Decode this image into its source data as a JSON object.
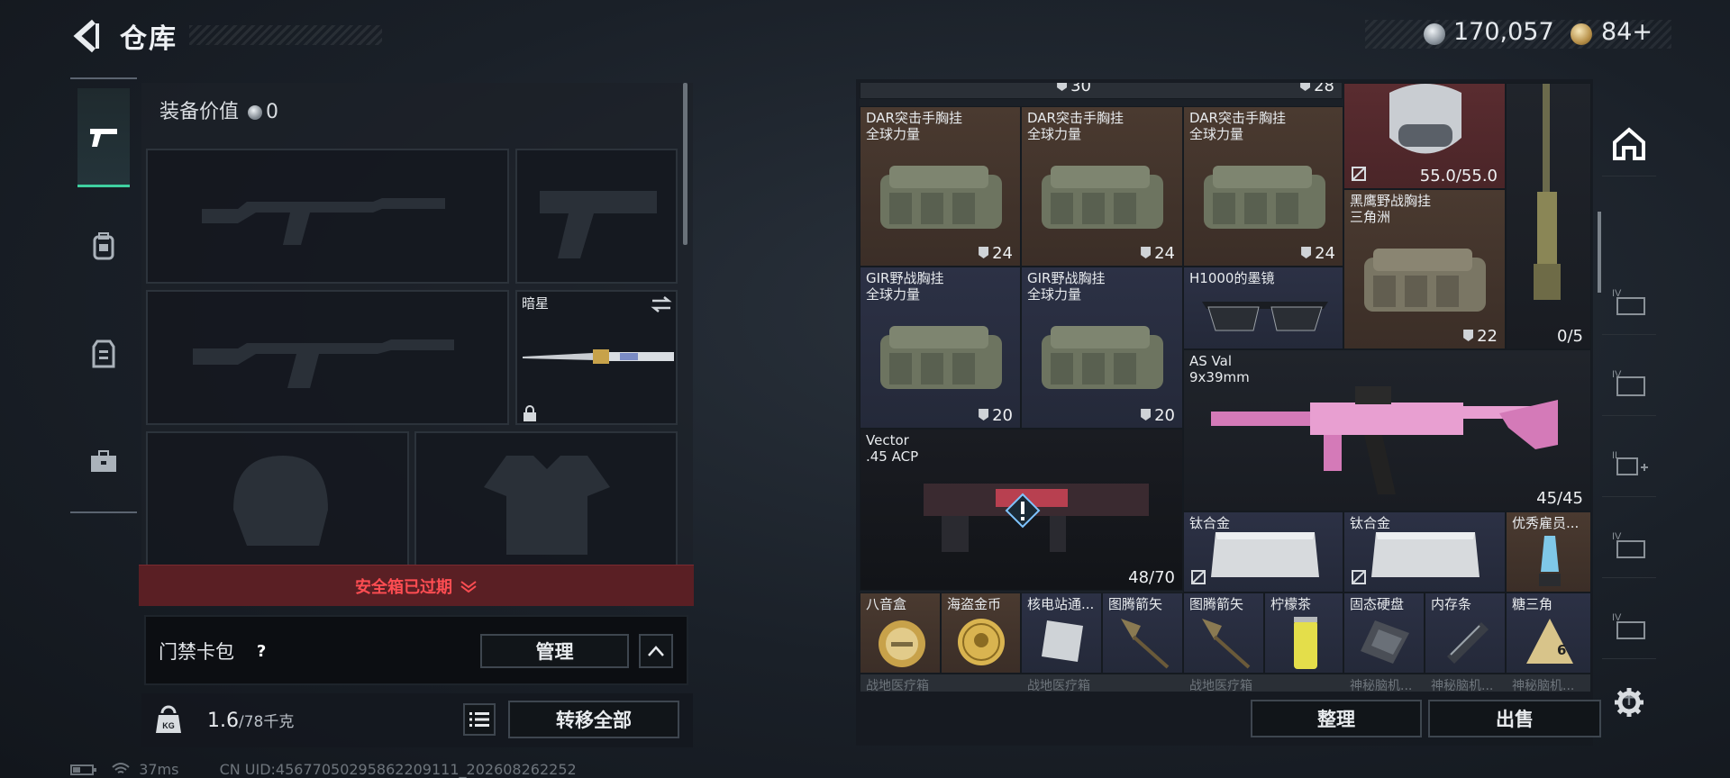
{
  "header": {
    "title": "仓库",
    "silver": "170,057",
    "gold": "84+"
  },
  "side_tabs": [
    {
      "name": "weapon-tab",
      "icon": "pistol-icon"
    },
    {
      "name": "backpack-tab",
      "icon": "backpack-icon"
    },
    {
      "name": "vest-tab",
      "icon": "vest-icon"
    },
    {
      "name": "case-tab",
      "icon": "toolbox-icon"
    }
  ],
  "loadout": {
    "equip_value_label": "装备价值",
    "equip_value": "0",
    "melee_name": "暗星",
    "safebox_status": "安全箱已过期",
    "keycard_label": "门禁卡包",
    "help": "?",
    "manage_label": "管理",
    "weight_current": "1.6",
    "weight_max": "/78千克",
    "transfer_all_label": "转移全部"
  },
  "status_bar": {
    "ping": "37ms",
    "uid": "CN UID:45677050295862209111_202608262252"
  },
  "inventory": {
    "top_counts": [
      "30",
      "28"
    ],
    "cells": [
      {
        "name": "DAR突击手胸挂",
        "sub": "全球力量",
        "count": "24"
      },
      {
        "name": "DAR突击手胸挂",
        "sub": "全球力量",
        "count": "24"
      },
      {
        "name": "DAR突击手胸挂",
        "sub": "全球力量",
        "count": "24"
      },
      {
        "name": "",
        "sub": "",
        "count": "55.0/55.0"
      },
      {
        "name": "黑鹰野战胸挂",
        "sub": "三角洲",
        "count": "22"
      },
      {
        "name": "",
        "sub": "",
        "count": "0/5"
      },
      {
        "name": "GIR野战胸挂",
        "sub": "全球力量",
        "count": "20"
      },
      {
        "name": "GIR野战胸挂",
        "sub": "全球力量",
        "count": "20"
      },
      {
        "name": "H1000的墨镜",
        "sub": "",
        "count": ""
      },
      {
        "name": "AS Val",
        "sub": "9x39mm",
        "count": "45/45"
      },
      {
        "name": "Vector",
        "sub": ".45 ACP",
        "count": "48/70"
      },
      {
        "name": "钛合金",
        "sub": "",
        "count": ""
      },
      {
        "name": "钛合金",
        "sub": "",
        "count": ""
      },
      {
        "name": "优秀雇员...",
        "sub": "",
        "count": ""
      }
    ],
    "small_items": [
      "八音盒",
      "海盗金币",
      "核电站通...",
      "图腾箭矢",
      "图腾箭矢",
      "柠檬茶",
      "固态硬盘",
      "内存条",
      "糖三角"
    ],
    "ghost_row": [
      "战地医疗箱",
      "战地医疗箱",
      "战地医疗箱",
      "神秘脑机...",
      "神秘脑机...",
      "神秘脑机..."
    ],
    "tidy_label": "整理",
    "sell_label": "出售",
    "badge": "6"
  },
  "filters": [
    "home-filter",
    "lvl4-filter-a",
    "lvl4-filter-b",
    "med-filter",
    "lvl4-filter-c",
    "lvl4-filter-d",
    "add-filter"
  ],
  "filter_level_labels": [
    "IV",
    "IV",
    "II",
    "IV",
    "IV"
  ],
  "add_filter_label": "+",
  "colors": {
    "accent_green": "#3fd0a0",
    "warning_red": "#ff4d52",
    "cell_brown": "#4a3a30",
    "cell_blue": "#2c3145",
    "cell_red": "#5a2c30"
  }
}
